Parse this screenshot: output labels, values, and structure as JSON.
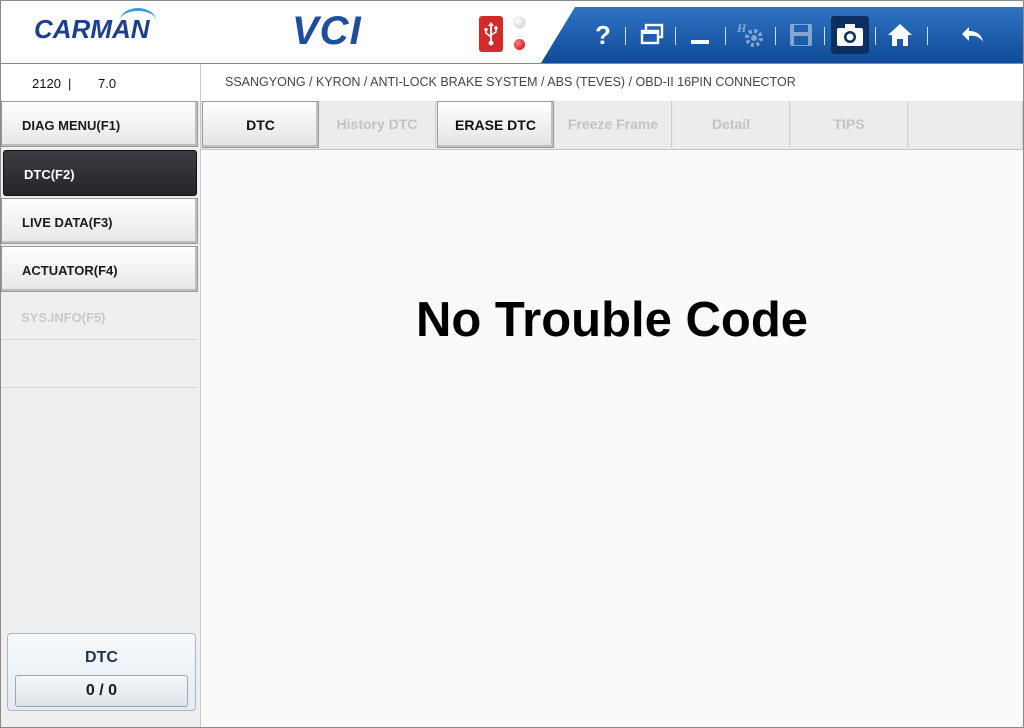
{
  "header": {
    "logo_text": "CARMAN",
    "product_name": "VCI",
    "usb_icon": "usb-icon",
    "toolbar_icons": [
      "help-icon",
      "window-icon",
      "minimize-icon",
      "h-settings-icon",
      "save-icon",
      "camera-icon",
      "home-icon",
      "back-icon"
    ],
    "help_label": "?"
  },
  "info": {
    "code": "2120",
    "separator": "|",
    "version": "7.0",
    "breadcrumb": "SSANGYONG / KYRON / ANTI-LOCK BRAKE SYSTEM / ABS (TEVES) / OBD-II 16PIN CONNECTOR"
  },
  "sidebar": {
    "items": [
      {
        "label": "DIAG MENU(F1)",
        "state": "enabled"
      },
      {
        "label": "DTC(F2)",
        "state": "active"
      },
      {
        "label": "LIVE DATA(F3)",
        "state": "enabled"
      },
      {
        "label": "ACTUATOR(F4)",
        "state": "enabled"
      },
      {
        "label": "SYS.INFO(F5)",
        "state": "disabled"
      }
    ],
    "dtc_box": {
      "title": "DTC",
      "count": "0 / 0"
    }
  },
  "tabs": [
    {
      "label": "DTC",
      "state": "enabled"
    },
    {
      "label": "History DTC",
      "state": "disabled"
    },
    {
      "label": "ERASE DTC",
      "state": "enabled"
    },
    {
      "label": "Freeze Frame",
      "state": "disabled"
    },
    {
      "label": "Detail",
      "state": "disabled"
    },
    {
      "label": "TIPS",
      "state": "disabled"
    }
  ],
  "main": {
    "message": "No Trouble Code"
  },
  "colors": {
    "brand_blue": "#1d4f9e",
    "toolbar_blue": "#1f5fae",
    "active_menu": "#2b2d31",
    "led_red": "#d10000"
  }
}
